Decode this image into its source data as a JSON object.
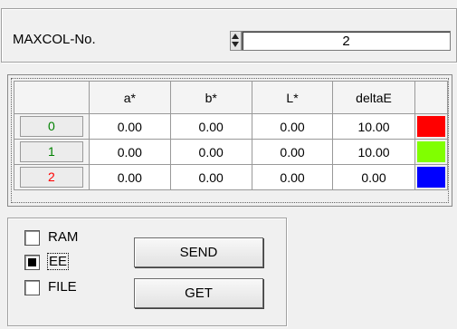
{
  "maxcol": {
    "label": "MAXCOL-No.",
    "value": "2"
  },
  "table": {
    "headers": [
      "",
      "a*",
      "b*",
      "L*",
      "deltaE",
      ""
    ],
    "rows": [
      {
        "index": "0",
        "index_color": "#008000",
        "a": "0.00",
        "b": "0.00",
        "L": "0.00",
        "deltaE": "10.00",
        "swatch": "#ff0000"
      },
      {
        "index": "1",
        "index_color": "#008000",
        "a": "0.00",
        "b": "0.00",
        "L": "0.00",
        "deltaE": "10.00",
        "swatch": "#80ff00"
      },
      {
        "index": "2",
        "index_color": "#ff0000",
        "a": "0.00",
        "b": "0.00",
        "L": "0.00",
        "deltaE": "0.00",
        "swatch": "#0000ff"
      }
    ]
  },
  "options": [
    {
      "label": "RAM",
      "checked": false
    },
    {
      "label": "EE",
      "checked": true
    },
    {
      "label": "FILE",
      "checked": false
    }
  ],
  "buttons": {
    "send": "SEND",
    "get": "GET"
  }
}
